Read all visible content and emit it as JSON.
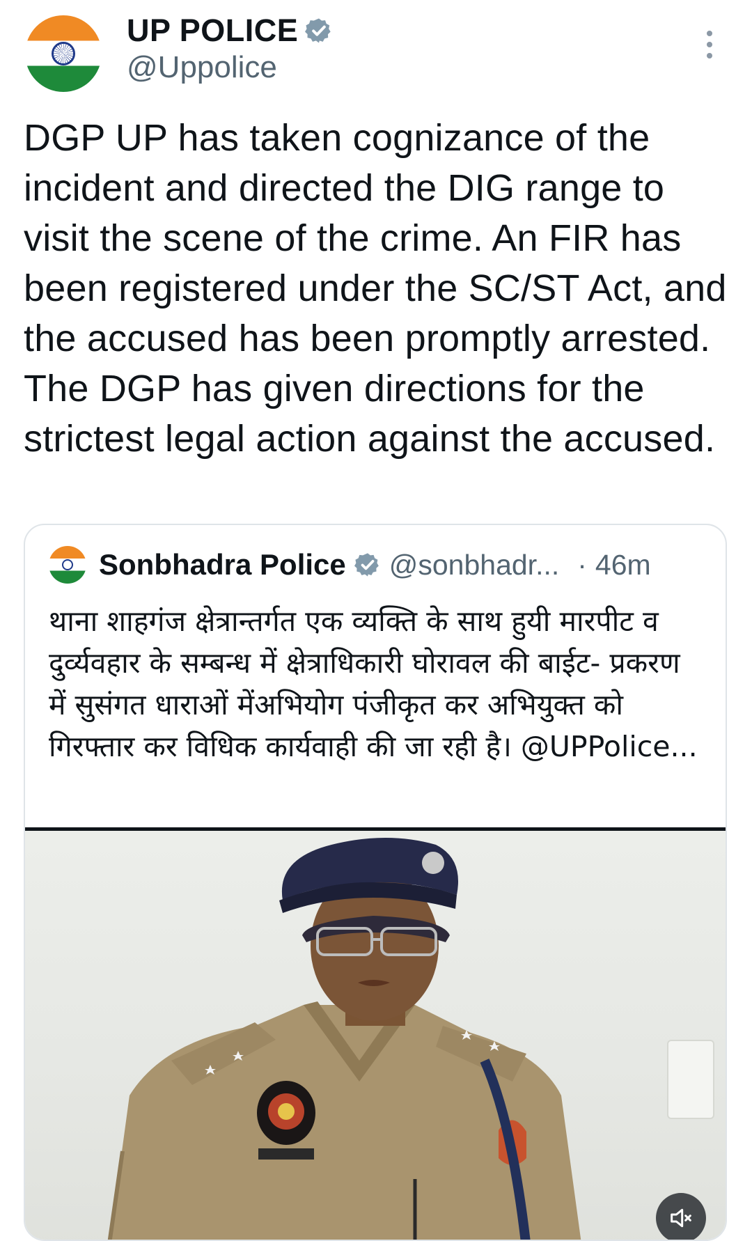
{
  "tweet": {
    "author_name": "UP POLICE",
    "author_handle": "@Uppolice",
    "text": "DGP UP has taken cognizance of the incident and directed the DIG range to visit the scene of the crime. An FIR has been registered under the SC/ST Act, and the accused has been promptly arrested. The DGP has given directions for the strictest legal action against the accused."
  },
  "quoted_tweet": {
    "author_name": "Sonbhadra Police",
    "author_handle": "@sonbhadr...",
    "separator": "·",
    "time": "46m",
    "text": "थाना शाहगंज क्षेत्रान्तर्गत एक व्यक्ति के साथ हुयी मारपीट व दुर्व्यवहार के सम्बन्ध में क्षेत्राधिकारी घोरावल की बाईट- प्रकरण में सुसंगत धाराओं मेंअभियोग पंजीकृत कर अभियुक्त को गिरफ्तार कर विधिक कार्यवाही की जा रही है। @UPPolice..."
  },
  "icons": {
    "verified": "verified-badge-icon",
    "more": "more-vertical-icon",
    "mute": "volume-muted-icon"
  },
  "colors": {
    "verified_badge": "#829aab",
    "secondary_text": "#536471",
    "border": "#dfe4e8"
  }
}
